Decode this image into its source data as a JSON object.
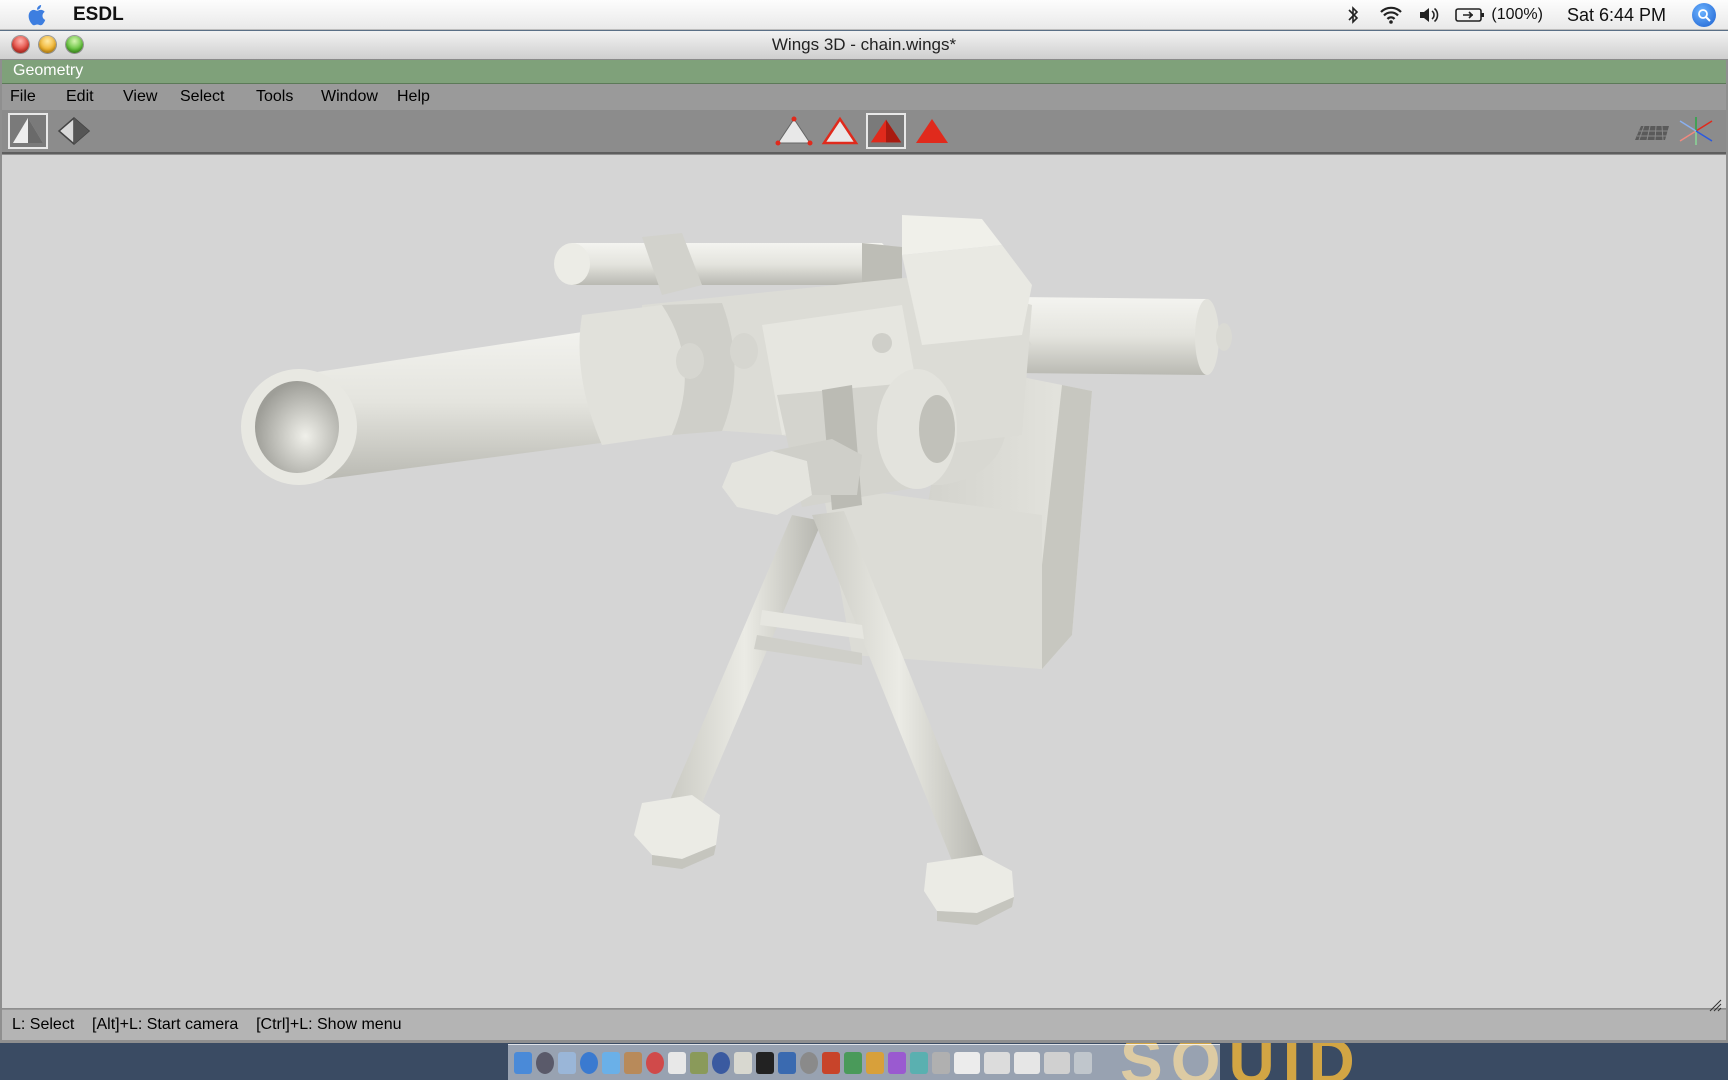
{
  "mac_menubar": {
    "app_name": "ESDL",
    "battery": "(100%)",
    "clock": "Sat 6:44 PM",
    "icons": [
      "apple-icon",
      "bluetooth-icon",
      "wifi-icon",
      "volume-icon",
      "battery-icon",
      "spotlight-icon"
    ]
  },
  "window": {
    "title": "Wings 3D - chain.wings*"
  },
  "geometry_bar": {
    "label": "Geometry"
  },
  "menu": {
    "items": [
      "File",
      "Edit",
      "View",
      "Select",
      "Tools",
      "Window",
      "Help"
    ]
  },
  "toolbar": {
    "left": [
      "smooth-shaded-view-icon",
      "wireframe-view-icon"
    ],
    "selection_modes": [
      "vertex-select-icon",
      "edge-select-icon",
      "face-select-icon",
      "body-select-icon"
    ],
    "active_selection_mode": "face-select-icon",
    "right": [
      "ground-plane-icon",
      "axes-icon"
    ]
  },
  "statusbar": {
    "text": "L: Select    [Alt]+L: Start camera    [Ctrl]+L: Show menu"
  },
  "desktop": {
    "backdrop_text": "SQUID"
  },
  "colors": {
    "geometry_bar": "#7fa17a",
    "viewport": "#d5d5d5",
    "selection_red": "#e02a1c"
  }
}
